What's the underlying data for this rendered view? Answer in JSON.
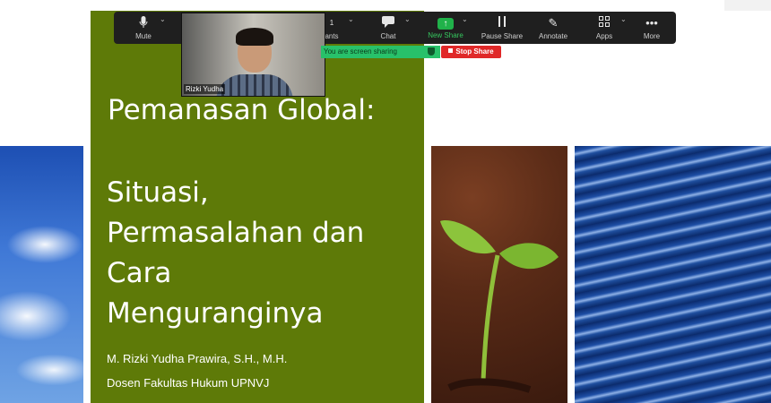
{
  "toolbar": {
    "mute_label": "Mute",
    "participants_label": "ants",
    "participants_count": "1",
    "chat_label": "Chat",
    "new_share_label": "New Share",
    "pause_share_label": "Pause Share",
    "annotate_label": "Annotate",
    "apps_label": "Apps",
    "more_label": "More",
    "icons": {
      "mute": "microphone-icon",
      "chat": "chat-icon",
      "new_share": "arrow-up-icon",
      "pause": "pause-icon",
      "annotate": "pencil-icon",
      "apps": "apps-icon",
      "more": "ellipsis-icon"
    }
  },
  "video": {
    "participant_name": "Rizki Yudha"
  },
  "share_status": {
    "banner_text": "You are screen sharing",
    "stop_label": "Stop Share",
    "banner_color": "#28c16a",
    "stop_color": "#e02828"
  },
  "slide": {
    "title": "Pemanasan Global:",
    "subtitle_lines": [
      "Situasi,",
      "Permasalahan dan",
      "Cara",
      "Menguranginya"
    ],
    "author": "M. Rizki Yudha Prawira, S.H., M.H.",
    "affiliation": "Dosen Fakultas Hukum UPNVJ",
    "background_color": "#5e7a08"
  }
}
